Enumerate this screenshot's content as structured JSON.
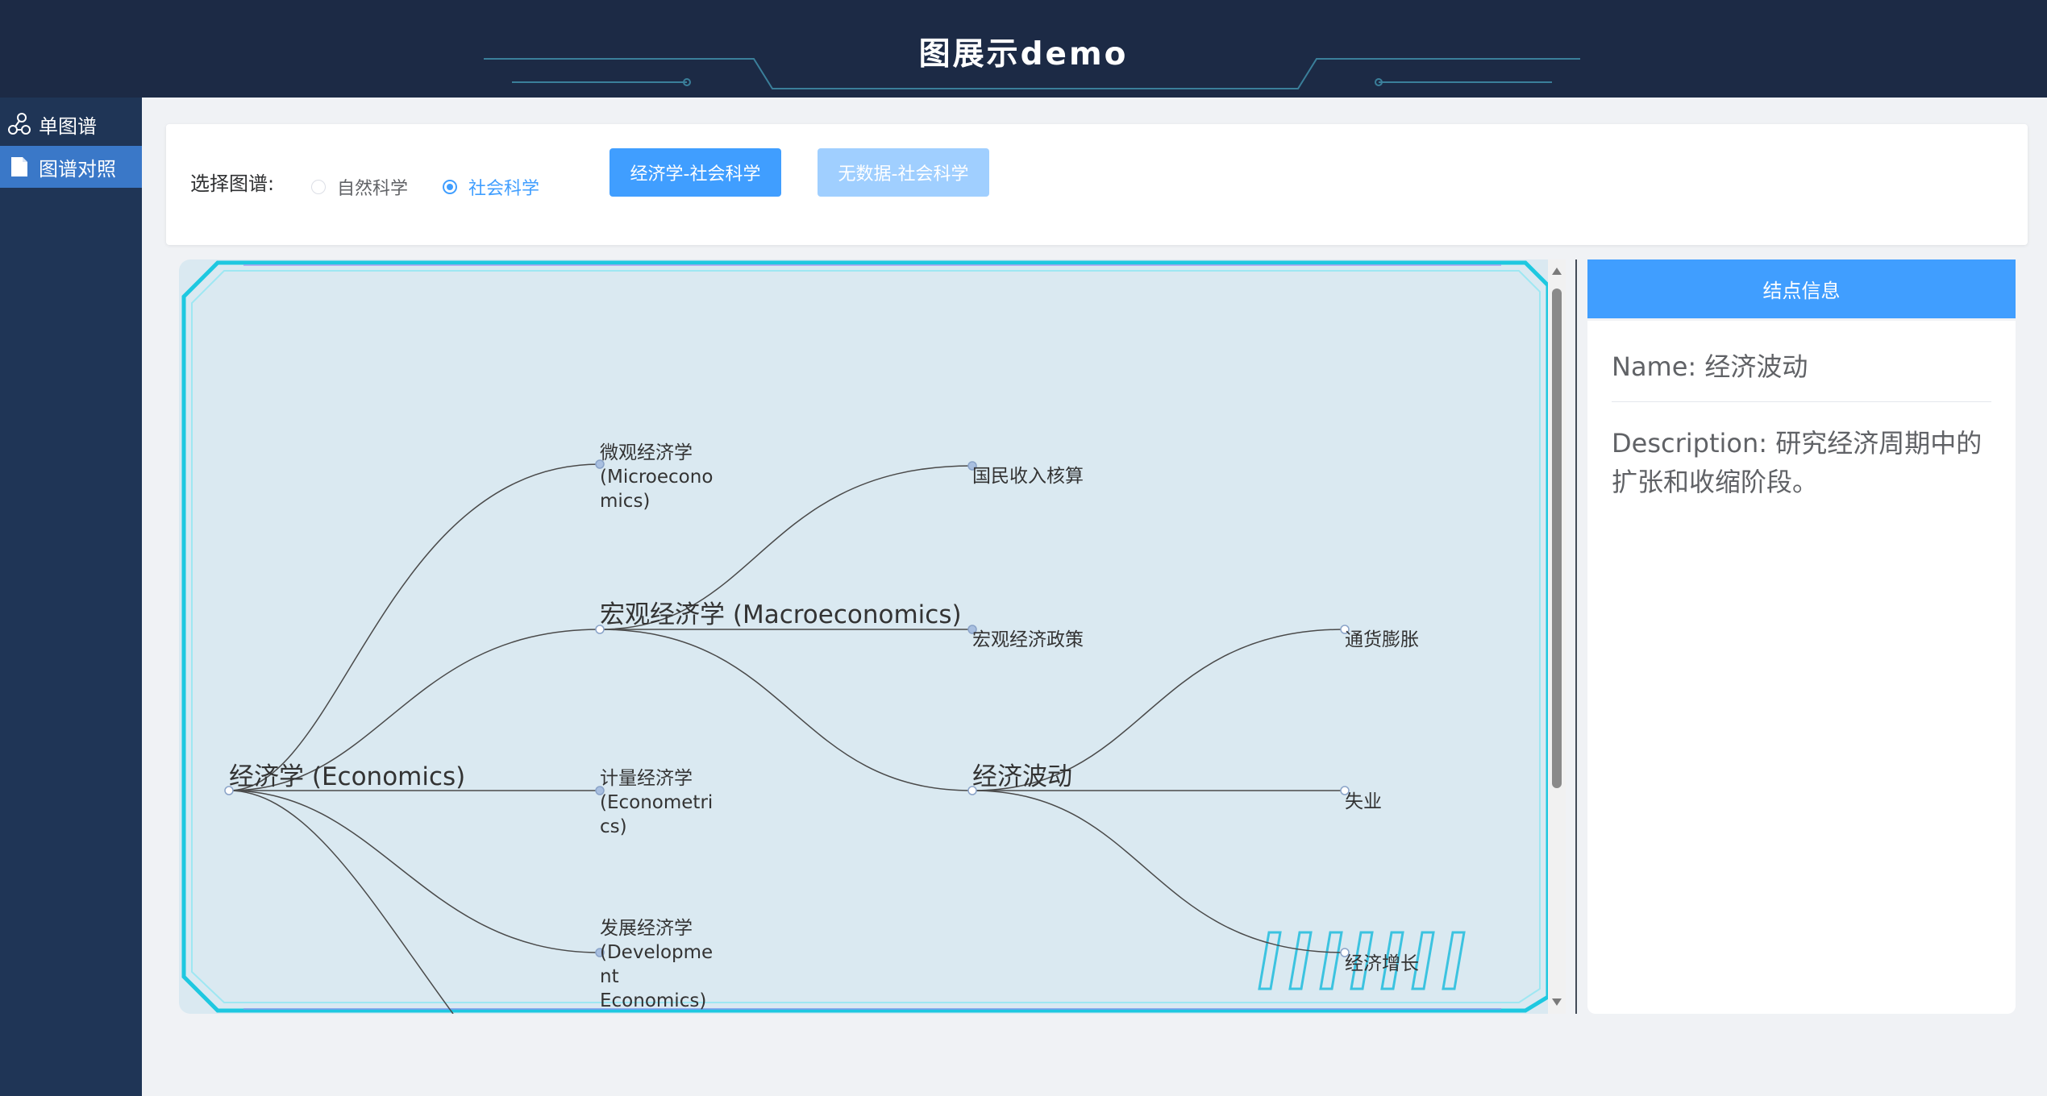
{
  "header": {
    "title": "图展示demo"
  },
  "sidebar": {
    "items": [
      {
        "label": "单图谱",
        "icon": "graph-icon",
        "active": false
      },
      {
        "label": "图谱对照",
        "icon": "document-icon",
        "active": true
      }
    ]
  },
  "toolbar": {
    "select_label": "选择图谱:",
    "radios": [
      {
        "label": "自然科学",
        "checked": false
      },
      {
        "label": "社会科学",
        "checked": true
      }
    ],
    "buttons": [
      {
        "label": "经济学-社会科学",
        "state": "enabled"
      },
      {
        "label": "无数据-社会科学",
        "state": "disabled"
      }
    ]
  },
  "graph": {
    "root": {
      "label": "经济学 (Economics)"
    },
    "level1": [
      {
        "label_lines": [
          "微观经济学",
          "(Microecono",
          "mics)"
        ]
      },
      {
        "label_lines": [
          "宏观经济学 (Macroeconomics)"
        ]
      },
      {
        "label_lines": [
          "计量经济学",
          "(Econometri",
          "cs)"
        ]
      },
      {
        "label_lines": [
          "发展经济学",
          "(Developme",
          "nt",
          "Economics)"
        ]
      }
    ],
    "level2": [
      {
        "label": "国民收入核算"
      },
      {
        "label": "宏观经济政策"
      },
      {
        "label": "经济波动"
      }
    ],
    "level3": [
      {
        "label": "通货膨胀"
      },
      {
        "label": "失业"
      },
      {
        "label": "经济增长"
      }
    ],
    "colors": {
      "background": "#dae9f1",
      "frame": "#1ec8e0",
      "edge": "#4a4a4a",
      "node": "#a8bfe0"
    }
  },
  "info_panel": {
    "title": "结点信息",
    "name": "Name: 经济波动",
    "description": "Description: 研究经济周期中的扩张和收缩阶段。"
  }
}
